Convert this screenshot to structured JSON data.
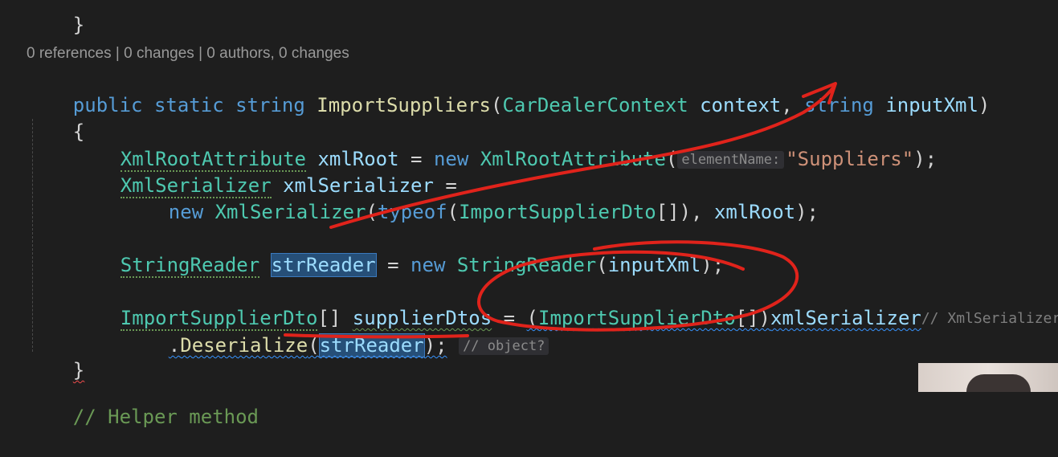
{
  "editor": {
    "codelens": "0 references | 0 changes | 0 authors, 0 changes",
    "line_top_brace": "}",
    "method_signature": {
      "kw_public": "public",
      "kw_static": "static",
      "kw_string": "string",
      "method_name": "ImportSuppliers",
      "paren_open": "(",
      "param1_type": "CarDealerContext",
      "param1_name": "context",
      "comma": ",",
      "param2_type": "string",
      "param2_name": "inputXml",
      "paren_close": ")"
    },
    "open_brace": "{",
    "xml_root_line": {
      "type": "XmlRootAttribute",
      "var": "xmlRoot",
      "eq": "=",
      "kw_new": "new",
      "ctor": "XmlRootAttribute",
      "paren_open": "(",
      "hint": "elementName:",
      "literal": "\"Suppliers\"",
      "tail": ");"
    },
    "serializer_line1": {
      "type": "XmlSerializer",
      "var": "xmlSerializer",
      "eq": "="
    },
    "serializer_line2": {
      "kw_new": "new",
      "ctor": "XmlSerializer",
      "paren_open": "(",
      "kw_typeof": "typeof",
      "paren_open2": "(",
      "dto_type": "ImportSupplierDto",
      "arr_tail": "[]),",
      "arg": "xmlRoot",
      "tail": ");"
    },
    "reader_line": {
      "type": "StringReader",
      "var": "strReader",
      "eq": "=",
      "kw_new": "new",
      "ctor": "StringReader",
      "paren_open": "(",
      "arg": "inputXml",
      "tail": ");"
    },
    "dtos_line": {
      "type": "ImportSupplierDto",
      "arr": "[]",
      "var": "supplierDtos",
      "eq": "=",
      "cast_open": "(",
      "cast_type": "ImportSupplierDto",
      "cast_close": "[])",
      "obj": "xmlSerializer",
      "hint": "// XmlSerializer"
    },
    "deserialize_line": {
      "dot": ".",
      "method": "Deserialize",
      "paren_open": "(",
      "arg": "strReader",
      "tail": ");",
      "hint": "// object?"
    },
    "close_brace": "}",
    "bottom_comment": "// Helper method"
  },
  "colors": {
    "background": "#1e1e1e",
    "keyword": "#569cd6",
    "type": "#4ec9b0",
    "method": "#dcdcaa",
    "identifier": "#9cdcfe",
    "string": "#ce9178",
    "annotation_pen": "#e0231b",
    "selection": "#264f78"
  }
}
